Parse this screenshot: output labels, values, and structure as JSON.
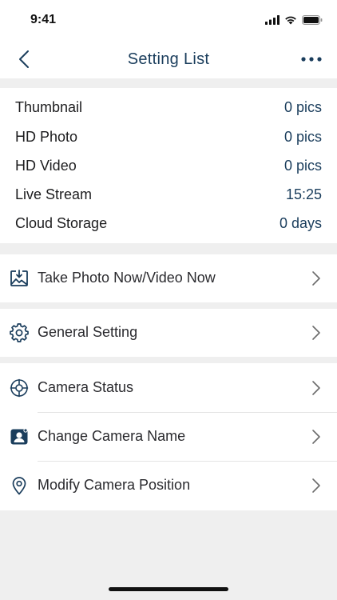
{
  "status_bar": {
    "time": "9:41"
  },
  "nav": {
    "title": "Setting List",
    "back_icon": "chevron-left-icon",
    "more_icon": "ellipsis-icon"
  },
  "stats": [
    {
      "label": "Thumbnail",
      "value": "0 pics"
    },
    {
      "label": "HD Photo",
      "value": "0 pics"
    },
    {
      "label": "HD Video",
      "value": "0 pics"
    },
    {
      "label": "Live Stream",
      "value": "15:25"
    },
    {
      "label": "Cloud Storage",
      "value": "0 days"
    }
  ],
  "menu": {
    "take_photo": {
      "label": "Take Photo Now/Video Now",
      "icon": "image-download-icon"
    },
    "general_setting": {
      "label": "General Setting",
      "icon": "gear-icon"
    },
    "camera_status": {
      "label": "Camera Status",
      "icon": "crosshair-icon"
    },
    "change_name": {
      "label": "Change Camera Name",
      "icon": "user-card-icon"
    },
    "modify_position": {
      "label": "Modify Camera Position",
      "icon": "location-pin-icon"
    }
  },
  "colors": {
    "accent": "#1a3d5c",
    "background": "#efefef",
    "card": "#ffffff"
  }
}
